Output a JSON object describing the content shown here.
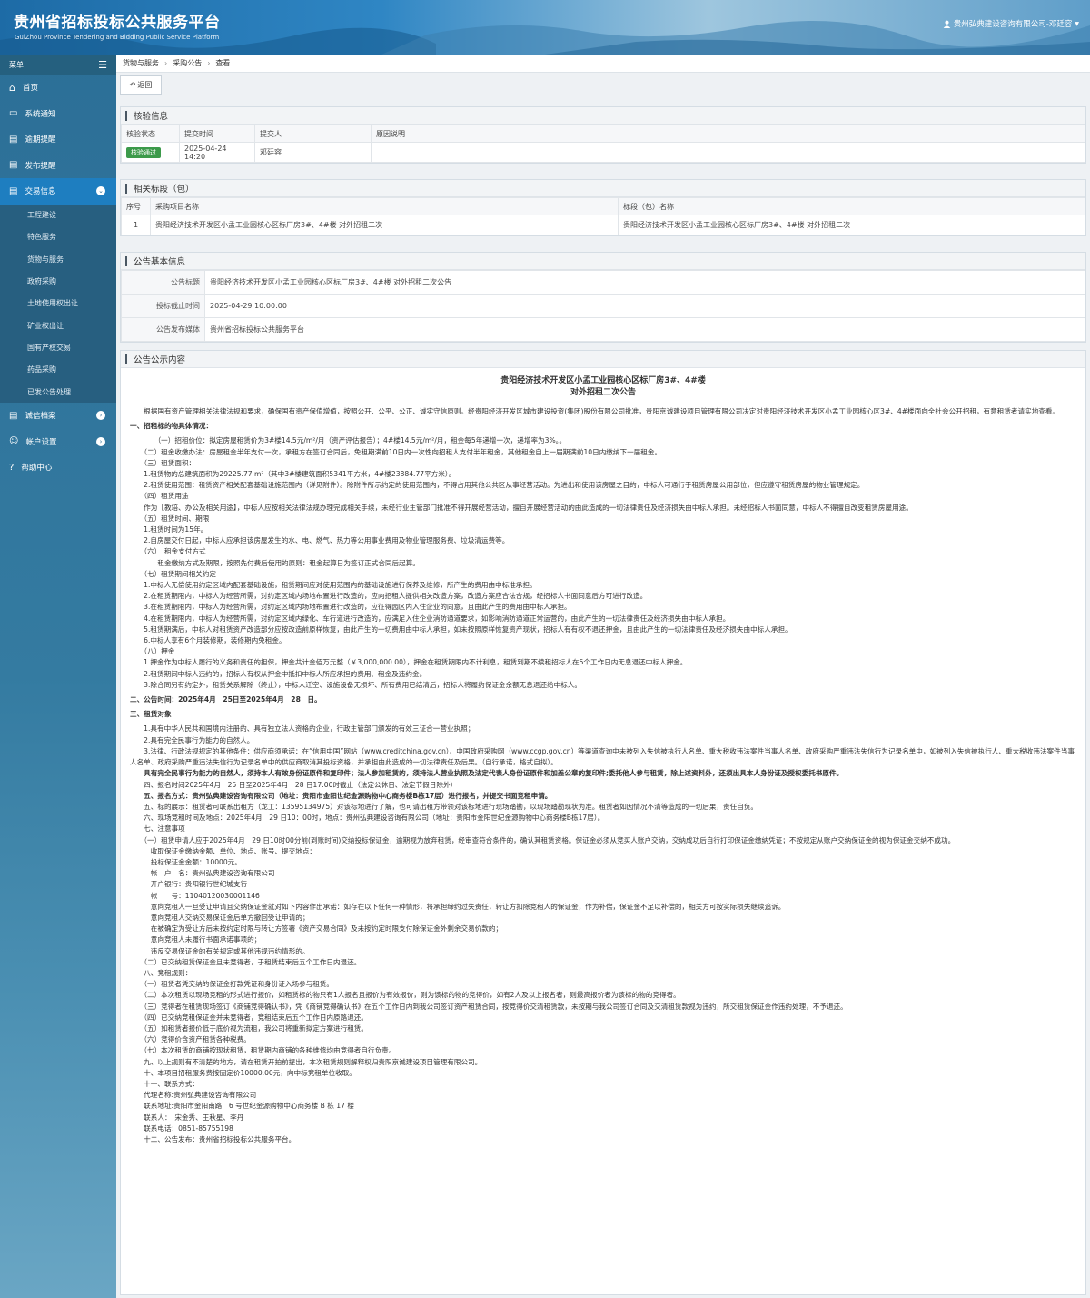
{
  "site": {
    "title": "贵州省招标投标公共服务平台",
    "subtitle": "GuiZhou Province Tendering and Bidding Public Service Platform",
    "user": "贵州弘典建设咨询有限公司-邓廷容"
  },
  "sidebar": {
    "menu_label": "菜单",
    "items": [
      "首页",
      "系统通知",
      "逾期提醒",
      "发布提醒",
      "交易信息",
      "诚信档案",
      "帐户设置",
      "帮助中心"
    ],
    "sub_items": [
      "工程建设",
      "特色服务",
      "货物与服务",
      "政府采购",
      "土地使用权出让",
      "矿业权出让",
      "国有产权交易",
      "药品采购",
      "已发公告处理"
    ]
  },
  "breadcrumb": [
    "货物与服务",
    "采购公告",
    "查看"
  ],
  "toolbar": {
    "back": "返回"
  },
  "verify": {
    "title": "核验信息",
    "headers": [
      "核验状态",
      "提交时间",
      "提交人",
      "原因说明"
    ],
    "status": "核验通过",
    "time": "2025-04-24 14:20",
    "submitter": "邓廷容",
    "reason": ""
  },
  "related": {
    "title": "相关标段（包）",
    "headers": [
      "序号",
      "采购项目名称",
      "标段（包）名称"
    ],
    "rows": [
      {
        "no": "1",
        "project": "贵阳经济技术开发区小孟工业园核心区标厂房3#、4#楼 对外招租二次",
        "section": "贵阳经济技术开发区小孟工业园核心区标厂房3#、4#楼 对外招租二次"
      }
    ]
  },
  "basic": {
    "title": "公告基本信息",
    "rows": [
      {
        "label": "公告标题",
        "value": "贵阳经济技术开发区小孟工业园核心区标厂房3#、4#楼 对外招租二次公告"
      },
      {
        "label": "投标截止时间",
        "value": "2025-04-29 10:00:00"
      },
      {
        "label": "公告发布媒体",
        "value": "贵州省招标投标公共服务平台"
      }
    ]
  },
  "notice": {
    "section_title": "公告公示内容",
    "title_line1": "贵阳经济技术开发区小孟工业园核心区标厂房3#、4#楼",
    "title_line2": "对外招租二次公告",
    "paras": [
      "　　根据国有资产管理相关法律法规和要求，确保国有资产保值增值，按照公开、公平、公正、诚实守信原则。经贵阳经济开发区城市建设投资(集团)股份有限公司批准，贵阳京诚建设项目管理有限公司决定对贵阳经济技术开发区小孟工业园核心区3#、4#楼面向全社会公开招租，有意租赁者请实地查看。",
      "##一、招租标的物具体情况：",
      "　　　　（一）招租价位：拟定房屋租赁价为3#楼14.5元/m²/月（资产评估报告）；4#楼14.5元/m²/月，租金每5年递增一次，递增率为3%。。",
      "　　（二）租金收缴办法：房屋租金半年支付一次，承租方在签订合同后，免租期满前10日内一次性向招租人支付半年租金，其他租金自上一届期满前10日内缴纳下一届租金。",
      "　　（三）租赁面积：",
      "　　1.租赁物的总建筑面积为29225.77 m²（其中3#楼建筑面积5341平方米，4#楼23884.77平方米）。",
      "　　2.租赁使用范围：租赁资产相关配套基础设施范围内（详见附件）。除附件所示约定的使用范围内，不得占用其他公共区从事经营活动。为进出和使用该房屋之目的，中标人可通行于租赁房屋公用部位，但应遵守租赁房屋的物业管理规定。",
      "　　（四）租赁用途",
      "　　作为【教培、办公及相关用途】，中标人应按相关法律法规办理完成相关手续，未经行业主管部门批准不得开展经营活动，擅自开展经营活动的由此造成的一切法律责任及经济损失由中标人承担。未经招标人书面同意，中标人不得擅自改变租赁房屋用途。",
      "　　（五）租赁时间、期限",
      "　　1.租赁时间为15年。",
      "　　2.自房屋交付日起，中标人应承担该房屋发生的水、电、燃气、热力等公用事业费用及物业管理服务费、垃圾清运费等。",
      "　　（六）　租金支付方式",
      "　　　　租金缴纳方式及期限，按照先付费后使用的原则：租金起算日为签订正式合同后起算。",
      "　　（七）租赁期间相关约定",
      "　　1.中标人无偿使用约定区域内配套基础设施，租赁期间应对使用范围内的基础设施进行保养及维修，所产生的费用由中标准承担。",
      "　　2.在租赁期限内，中标人为经营所需，对约定区域内场地布置进行改造的，应向招租人提供相关改造方案，改造方案应合法合规，经招标人书面同意后方可进行改造。",
      "　　3.在租赁期限内，中标人为经营所需，对约定区域内场地布置进行改造的，应征得园区内入住企业的同意，且由此产生的费用由中标人承担。",
      "　　4.在租赁期限内，中标人为经营所需，对约定区域内绿化、车行道进行改造的，应满足入住企业消防通道要求，如影响消防通道正常运营的，由此产生的一切法律责任及经济损失由中标人承担。",
      "　　5.租赁期满后，中标人对租赁资产改造部分应按改造前原样恢复，由此产生的一切费用由中标人承担，如未按照原样恢复资产现状，招标人有有权不退还押金，且由此产生的一切法律责任及经济损失由中标人承担。",
      "　　6.中标人享有6个月装修期，装修期内免租金。",
      "　　（八）押金",
      "　　1.押金作为中标人履行的义务和责任的担保，押金共计金佰万元整（￥3,000,000.00），押金在租赁期限内不计利息，租赁到期不续租招标人在5个工作日内无息退还中标人押金。",
      "　　2.租赁期间中标人违约的，招标人有权从押金中抵扣中标人所应承担的费用、租金及违约金。",
      "　　3.除合同另有约定外，租赁关系解除（终止），中标人迁空、设施设备无损坏、所有费用已结清后，招标人将履约保证金余额无息退还给中标人。",
      "##二、公告时间：2025年4月　25日至2025年4月　28　日。",
      "##三、租赁对象",
      "　　1.具有中华人民共和国境内注册的、具有独立法人资格的企业，行政主管部门颁发的有效三证合一营业执照；",
      "　　2.具有完全民事行为能力的自然人。",
      "　　3.法律、行政法规规定的其他条件：供应商须承诺：在“信用中国”网站（www.creditchina.gov.cn）、中国政府采购网（www.ccgp.gov.cn）等渠道查询中未被列入失信被执行人名单、重大税收违法案件当事人名单、政府采购严重违法失信行为记录名单中，如被列入失信被执行人、重大税收违法案件当事人名单、政府采购严重违法失信行为记录名单中的供应商取消其投标资格，并承担由此造成的一切法律责任及后果。（自行承诺，格式自拟）。",
      "##　　具有完全民事行为能力的自然人，须持本人有效身份证原件和复印件；法人参加租赁的，须持法人营业执照及法定代表人身份证原件和加盖公章的复印件;委托他人参与租赁，除上述资料外，还须出具本人身份证及授权委托书原件。",
      "　　四、报名时间2025年4月　25 日至2025年4月　28 日17:00时截止（法定公休日、法定节假日除外）",
      "　　##五、报名方式：贵州弘典建设咨询有限公司（地址：贵阳市金阳世纪金源购物中心商务楼B栋17层）进行报名，并提交书面竞租申请。",
      "　　五、标的展示：租赁者可联系出租方（龙工：13595134975）对该标地进行了解，也可请出租方带领对该标地进行现场踏勘，以现场踏勘现状为准。租赁者如因情况不清等造成的一切后果，责任自负。",
      "　　六、现场竞租时间及地点：2025年4月　29 日10：00时，地点：贵州弘典建设咨询有限公司（地址：贵阳市金阳世纪金源购物中心商务楼B栋17层）。",
      "　　七、注意事项",
      "　　（一）租赁申请人应于2025年4月　29 日10时00分前(到账时间)交纳投标保证金，逾期视为放弃租赁，经审查符合条件的，确认其租赁资格。保证金必须从竞买人账户交纳，交纳成功后自行打印保证金缴纳凭证；不按规定从账户交纳保证金的视为保证金交纳不成功。",
      "　　　收取保证金缴纳金额、单位、地点、账号、提交地点：",
      "　　　投标保证金金额：10000元。",
      "　　　帐　户　名：贵州弘典建设咨询有限公司",
      "　　　开户银行：贵阳银行世纪城支行",
      "　　　帐　　号：11040120030001146",
      "　　　意向竞租人一旦受让申请且交纳保证金就对如下内容作出承诺：如存在以下任何一种情形，将承担缔约过失责任，转让方扣除竞租人的保证金，作为补偿，保证金不足以补偿的，相关方可按实际损失继续追诉。",
      "　　　意向竞租人交纳交易保证金后单方撤回受让申请的；",
      "　　　在被确定为受让方后未按约定时限与转让方签署《资产交易合同》及未按约定时限支付除保证金外剩余交易价款的；",
      "　　　意向竞租人未履行书面承诺事项的；",
      "　　　违反交易保证金的有关规定或其他违规违约情形的。",
      "　　（二）已交纳租赁保证金且未竞得者，于租赁结束后五个工作日内退还。",
      "　　八、竞租规则：",
      "　　（一）租赁者凭交纳的保证金打款凭证和身份证入场参与租赁。",
      "　　（二）本次租赁以现场竞租的形式进行报价，如租赁标的物只有1人报名且报价为有效报价，则为该标的物的竞得价，如有2人及以上报名者，则最高报价者为该标的物的竞得者。",
      "　　（三）竞得者在租赁现场签订《商铺竞得确认书》，凭《商铺竞得确认书》在五个工作日内到我公司签订资产租赁合同，按竞得价交清租赁款，未按期与我公司签订合同及交清租赁款视为违约，所交租赁保证金作违约处理，不予退还。",
      "　　（四）已交纳竞租保证金并未竞得者，竞租结束后五个工作日内原路退还。",
      "　　（五）如租赁者报价低于底价视为流租，我公司将重新拟定方案进行租赁。",
      "　　（六）竞得价含资产租赁各种税费。",
      "　　（七）本次租赁的商铺按现状租赁，租赁期内商铺的各种维修均由竞得者自行负责。",
      "　　九、以上规则有不清楚的地方，请在租赁开拍前提出，本次租赁规则解释权归贵阳京诚建设项目管理有限公司。",
      "　　十、本项目招租服务费按固定价10000.00元，向中标竞租单位收取。",
      "　　十一、联系方式：",
      "　　代理名称:贵州弘典建设咨询有限公司",
      "　　联系地址:贵阳市金阳南路　6 号世纪金源购物中心商务楼 B 栋 17 楼",
      "　　联系人：　宋金秀、王秋星、李丹",
      "　　联系电话：0851-85755198",
      "　　十二、公告发布：贵州省招标投标公共服务平台。"
    ]
  }
}
